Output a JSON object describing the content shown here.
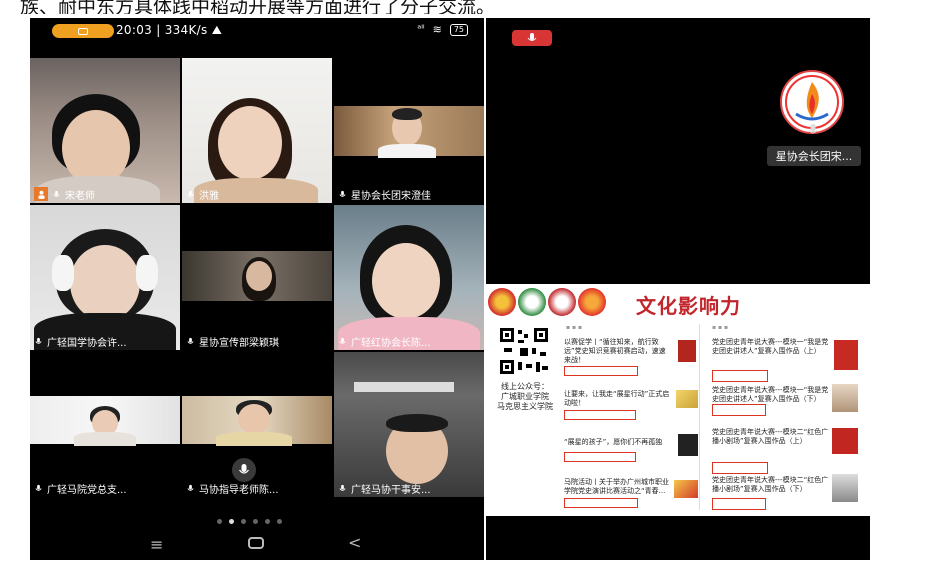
{
  "caption_text": "族、耐中东方具体践中稻动开展等方面进行了分子交流。",
  "status": {
    "time": "20:03",
    "speed": "334K/s",
    "battery": "75"
  },
  "tiles": [
    {
      "name": "宋老师",
      "host": true
    },
    {
      "name": "洪雅",
      "host": false
    },
    {
      "name": "星协会长团宋澄佳",
      "host": false
    },
    {
      "name": "广轻国学协会许...",
      "host": false
    },
    {
      "name": "星协宣传部梁颖琪",
      "host": false
    },
    {
      "name": "广轻红协会长陈...",
      "host": false
    },
    {
      "name": "广轻马院党总支...",
      "host": false
    },
    {
      "name": "马协指导老师陈...",
      "host": false
    },
    {
      "name": "广轻马协干事安...",
      "host": false
    }
  ],
  "pager": {
    "count": 6,
    "active_index": 1
  },
  "right_panel": {
    "speaker_label": "星协会长团宋...",
    "slide_title": "文化影响力",
    "qr_caption": [
      "线上公众号：",
      "广城职业学院",
      "马克思主义学院"
    ],
    "articles_left": [
      "以赛促学丨“循往知来，航行致远”党史知识竞赛初赛启动，速速来战！",
      "让要来，让我走“展星行动”正式启动啦！",
      "“展星的孩子”，愿你们不再孤独",
      "马院活动丨关于举办广州城市职业学院党史演讲比赛活动之“青春..."
    ],
    "articles_right": [
      "党史团史青年说大赛---模块一“我是党史团史讲述人”复赛入围作品（上）",
      "党史团史青年说大赛---模块一“我是党史团史讲述人”复赛入围作品（下）",
      "党史团史青年说大赛---模块二“红色广播小剧场”复赛入围作品（上）",
      "党史团史青年说大赛---模块二“红色广播小剧场”复赛入围作品（下）"
    ]
  }
}
